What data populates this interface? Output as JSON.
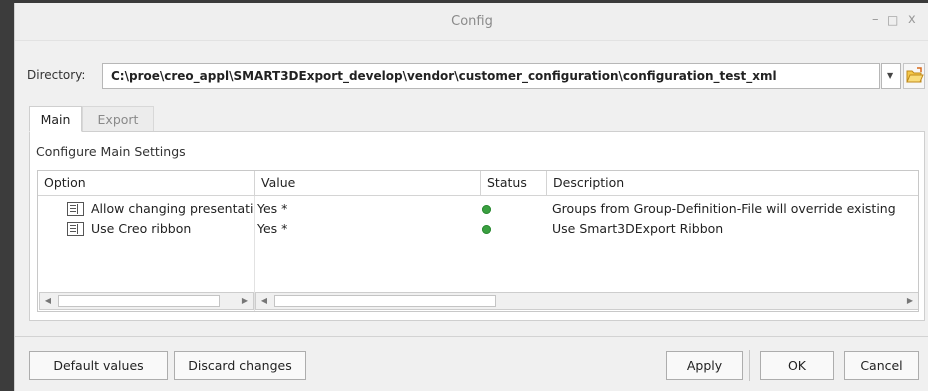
{
  "window": {
    "title": "Config",
    "minimize": "–",
    "maximize": "□",
    "close": "x"
  },
  "directory": {
    "label": "Directory:",
    "value": "C:\\proe\\creo_appl\\SMART3DExport_develop\\vendor\\customer_configuration\\configuration_test_xml",
    "dropdown_icon": "▼"
  },
  "tabs": [
    {
      "label": "Main",
      "active": true
    },
    {
      "label": "Export",
      "active": false
    }
  ],
  "panel": {
    "title": "Configure Main Settings"
  },
  "table": {
    "columns": [
      "Option",
      "Value",
      "Status",
      "Description"
    ],
    "rows": [
      {
        "option": "Allow changing presentation",
        "value": "Yes *",
        "status": "green",
        "description": "Groups from Group-Definition-File will override existing"
      },
      {
        "option": "Use Creo ribbon",
        "value": "Yes *",
        "status": "green",
        "description": "Use Smart3DExport Ribbon"
      }
    ]
  },
  "buttons": {
    "default_values": "Default values",
    "discard_changes": "Discard changes",
    "apply": "Apply",
    "ok": "OK",
    "cancel": "Cancel"
  },
  "colors": {
    "status_ok": "#3aa040"
  }
}
